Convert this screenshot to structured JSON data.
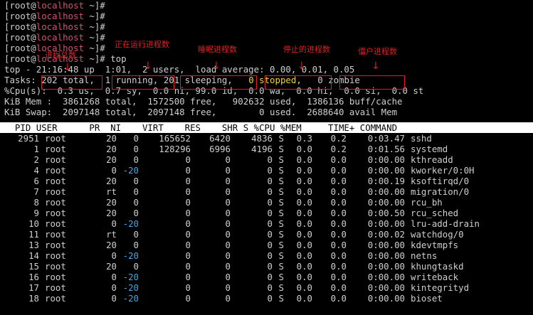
{
  "prompt_lines": [
    {
      "pre": "[root@",
      "host": "localhost",
      "post": " ~]#"
    },
    {
      "pre": "[root@",
      "host": "localhost",
      "post": " ~]#"
    },
    {
      "pre": "[root@",
      "host": "localhost",
      "post": " ~]#"
    },
    {
      "pre": "[root@",
      "host": "localhost",
      "post": " ~]#"
    },
    {
      "pre": "[root@",
      "host": "localhost",
      "post": " ~]#"
    }
  ],
  "last_prompt": {
    "pre": "[root@",
    "host": "localhost",
    "post": " ~]#",
    "cmd": " top"
  },
  "top_line": "top - 21:16:48 up  1:01,  2 users,  load average: 0.00, 0.01, 0.05",
  "tasks": {
    "label": "Tasks:",
    "total": "202 total,",
    "running": "1 running,",
    "sleeping": "201 sleeping,",
    "stopped": "0 stopped,",
    "zombie": "0 zombie"
  },
  "cpu_line": "%Cpu(s):  0.3 us,  0.7 sy,  0.0 ni, 99.0 id,  0.0 wa,  0.0 hi,  0.0 si,  0.0 st",
  "mem_line": "KiB Mem :  3861268 total,  1572500 free,   902632 used,  1386136 buff/cache",
  "swap_line": "KiB Swap:  2097148 total,  2097148 free,        0 used.  2688640 avail Mem",
  "table_header": "  PID USER      PR  NI    VIRT    RES    SHR S %CPU %MEM     TIME+ COMMAND",
  "processes": [
    {
      "pid": "2951",
      "user": "root",
      "pr": "20",
      "ni": "0",
      "virt": "165652",
      "res": "6420",
      "shr": "4836",
      "s": "S",
      "cpu": "0.3",
      "mem": "0.2",
      "time": "0:03.47",
      "cmd": "sshd"
    },
    {
      "pid": "1",
      "user": "root",
      "pr": "20",
      "ni": "0",
      "virt": "128296",
      "res": "6996",
      "shr": "4196",
      "s": "S",
      "cpu": "0.0",
      "mem": "0.2",
      "time": "0:01.56",
      "cmd": "systemd"
    },
    {
      "pid": "2",
      "user": "root",
      "pr": "20",
      "ni": "0",
      "virt": "0",
      "res": "0",
      "shr": "0",
      "s": "S",
      "cpu": "0.0",
      "mem": "0.0",
      "time": "0:00.00",
      "cmd": "kthreadd"
    },
    {
      "pid": "4",
      "user": "root",
      "pr": "0",
      "ni": "-20",
      "virt": "0",
      "res": "0",
      "shr": "0",
      "s": "S",
      "cpu": "0.0",
      "mem": "0.0",
      "time": "0:00.00",
      "cmd": "kworker/0:0H"
    },
    {
      "pid": "6",
      "user": "root",
      "pr": "20",
      "ni": "0",
      "virt": "0",
      "res": "0",
      "shr": "0",
      "s": "S",
      "cpu": "0.0",
      "mem": "0.0",
      "time": "0:00.19",
      "cmd": "ksoftirqd/0"
    },
    {
      "pid": "7",
      "user": "root",
      "pr": "rt",
      "ni": "0",
      "virt": "0",
      "res": "0",
      "shr": "0",
      "s": "S",
      "cpu": "0.0",
      "mem": "0.0",
      "time": "0:00.00",
      "cmd": "migration/0"
    },
    {
      "pid": "8",
      "user": "root",
      "pr": "20",
      "ni": "0",
      "virt": "0",
      "res": "0",
      "shr": "0",
      "s": "S",
      "cpu": "0.0",
      "mem": "0.0",
      "time": "0:00.00",
      "cmd": "rcu_bh"
    },
    {
      "pid": "9",
      "user": "root",
      "pr": "20",
      "ni": "0",
      "virt": "0",
      "res": "0",
      "shr": "0",
      "s": "S",
      "cpu": "0.0",
      "mem": "0.0",
      "time": "0:00.50",
      "cmd": "rcu_sched"
    },
    {
      "pid": "10",
      "user": "root",
      "pr": "0",
      "ni": "-20",
      "virt": "0",
      "res": "0",
      "shr": "0",
      "s": "S",
      "cpu": "0.0",
      "mem": "0.0",
      "time": "0:00.00",
      "cmd": "lru-add-drain"
    },
    {
      "pid": "11",
      "user": "root",
      "pr": "rt",
      "ni": "0",
      "virt": "0",
      "res": "0",
      "shr": "0",
      "s": "S",
      "cpu": "0.0",
      "mem": "0.0",
      "time": "0:00.02",
      "cmd": "watchdog/0"
    },
    {
      "pid": "13",
      "user": "root",
      "pr": "20",
      "ni": "0",
      "virt": "0",
      "res": "0",
      "shr": "0",
      "s": "S",
      "cpu": "0.0",
      "mem": "0.0",
      "time": "0:00.00",
      "cmd": "kdevtmpfs"
    },
    {
      "pid": "14",
      "user": "root",
      "pr": "0",
      "ni": "-20",
      "virt": "0",
      "res": "0",
      "shr": "0",
      "s": "S",
      "cpu": "0.0",
      "mem": "0.0",
      "time": "0:00.00",
      "cmd": "netns"
    },
    {
      "pid": "15",
      "user": "root",
      "pr": "20",
      "ni": "0",
      "virt": "0",
      "res": "0",
      "shr": "0",
      "s": "S",
      "cpu": "0.0",
      "mem": "0.0",
      "time": "0:00.00",
      "cmd": "khungtaskd"
    },
    {
      "pid": "16",
      "user": "root",
      "pr": "0",
      "ni": "-20",
      "virt": "0",
      "res": "0",
      "shr": "0",
      "s": "S",
      "cpu": "0.0",
      "mem": "0.0",
      "time": "0:00.00",
      "cmd": "writeback"
    },
    {
      "pid": "17",
      "user": "root",
      "pr": "0",
      "ni": "-20",
      "virt": "0",
      "res": "0",
      "shr": "0",
      "s": "S",
      "cpu": "0.0",
      "mem": "0.0",
      "time": "0:00.00",
      "cmd": "kintegrityd"
    },
    {
      "pid": "18",
      "user": "root",
      "pr": "0",
      "ni": "-20",
      "virt": "0",
      "res": "0",
      "shr": "0",
      "s": "S",
      "cpu": "0.0",
      "mem": "0.0",
      "time": "0:00.00",
      "cmd": "bioset"
    }
  ],
  "annotations": {
    "total_label": "进程总数",
    "running_label": "正在运行进程数",
    "sleeping_label": "睡眠进程数",
    "stopped_label": "停止的进程数",
    "zombie_label": "僵户进程数"
  },
  "colors": {
    "background": "#000000",
    "text": "#cfcfcf",
    "hostname": "#d94f6f",
    "annotation_red": "#e02020",
    "negative_nice": "#3fa8e8",
    "stopped_yellow": "#e9d44a"
  }
}
